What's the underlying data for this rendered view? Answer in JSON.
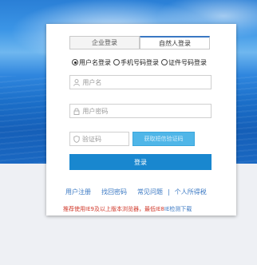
{
  "tabs": [
    {
      "label": "企业登录",
      "active": false
    },
    {
      "label": "自然人登录",
      "active": true
    }
  ],
  "login_modes": [
    {
      "label": "用户名登录",
      "checked": true
    },
    {
      "label": "手机号码登录",
      "checked": false
    },
    {
      "label": "证件号码登录",
      "checked": false
    }
  ],
  "fields": {
    "username_placeholder": "用户名",
    "password_placeholder": "用户密码",
    "captcha_placeholder": "验证码"
  },
  "buttons": {
    "get_code": "获取短信验证码",
    "login": "登录"
  },
  "links": {
    "register": "用户注册",
    "recover_password": "找回密码",
    "faq": "常见问题",
    "separator": "|",
    "personal_income_tax": "个人所得税"
  },
  "notice": {
    "text": "推荐使用IE9及以上版本浏览器，最低IE8",
    "link": "IE检测下载"
  },
  "colors": {
    "primary": "#1987cf",
    "code_button": "#4fb6e8",
    "link": "#3a78c3",
    "notice_red": "#d0392b"
  },
  "icons": {
    "username": "user-icon",
    "password": "lock-icon",
    "captcha": "shield-icon"
  }
}
